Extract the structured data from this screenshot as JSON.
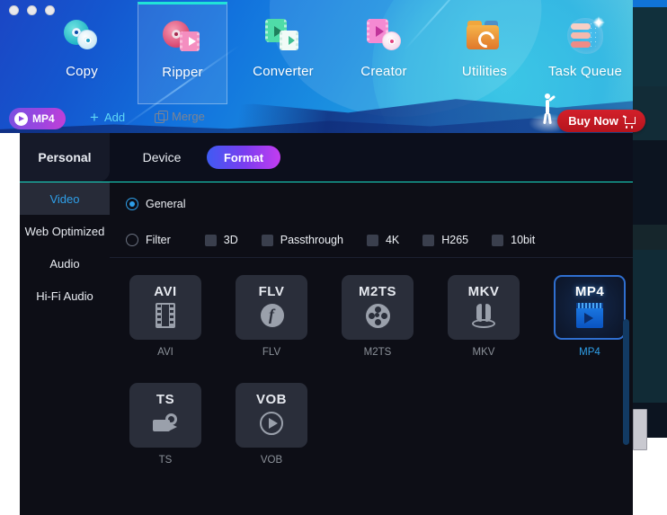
{
  "window": {
    "controls": [
      "close",
      "minimize",
      "maximize"
    ]
  },
  "nav": {
    "items": [
      {
        "label": "Copy",
        "icon": "disc-copy-icon",
        "selected": false
      },
      {
        "label": "Ripper",
        "icon": "disc-ripper-icon",
        "selected": true
      },
      {
        "label": "Converter",
        "icon": "film-converter-icon",
        "selected": false
      },
      {
        "label": "Creator",
        "icon": "film-creator-icon",
        "selected": false
      },
      {
        "label": "Utilities",
        "icon": "folder-utilities-icon",
        "selected": false
      },
      {
        "label": "Task Queue",
        "icon": "task-queue-icon",
        "selected": false
      }
    ]
  },
  "actions": {
    "format_badge": "MP4",
    "add_label": "Add",
    "merge_label": "Merge",
    "buy_label": "Buy Now"
  },
  "tabs": [
    {
      "label": "Personal",
      "active": true
    },
    {
      "label": "Device",
      "active": false
    },
    {
      "label": "Format",
      "active": false,
      "highlighted": true
    }
  ],
  "sidebar": {
    "items": [
      {
        "label": "Video",
        "active": true
      },
      {
        "label": "Web Optimized",
        "active": false
      },
      {
        "label": "Audio",
        "active": false
      },
      {
        "label": "Hi-Fi Audio",
        "active": false
      }
    ]
  },
  "filters": {
    "general": {
      "label": "General",
      "type": "radio",
      "checked": true
    },
    "filter": {
      "label": "Filter",
      "type": "radio",
      "checked": false
    },
    "options": [
      {
        "label": "3D",
        "checked": false
      },
      {
        "label": "Passthrough",
        "checked": false
      },
      {
        "label": "4K",
        "checked": false
      },
      {
        "label": "H265",
        "checked": false
      },
      {
        "label": "10bit",
        "checked": false
      }
    ]
  },
  "formats": [
    {
      "code": "AVI",
      "caption": "AVI",
      "gfx": "film-strip-icon",
      "selected": false
    },
    {
      "code": "FLV",
      "caption": "FLV",
      "gfx": "flash-icon",
      "selected": false
    },
    {
      "code": "M2TS",
      "caption": "M2TS",
      "gfx": "film-reel-icon",
      "selected": false
    },
    {
      "code": "MKV",
      "caption": "MKV",
      "gfx": "matroska-icon",
      "selected": false
    },
    {
      "code": "MP4",
      "caption": "MP4",
      "gfx": "mp4-player-icon",
      "selected": true
    },
    {
      "code": "TS",
      "caption": "TS",
      "gfx": "camcorder-icon",
      "selected": false
    },
    {
      "code": "VOB",
      "caption": "VOB",
      "gfx": "play-circle-icon",
      "selected": false
    }
  ],
  "colors": {
    "accent_cyan": "#18e0c8",
    "accent_blue": "#2f9fe8",
    "format_gradient_start": "#3f5bf2",
    "format_gradient_end": "#c33df0",
    "buy_red": "#d3202a",
    "panel_bg": "#0d0e16"
  }
}
